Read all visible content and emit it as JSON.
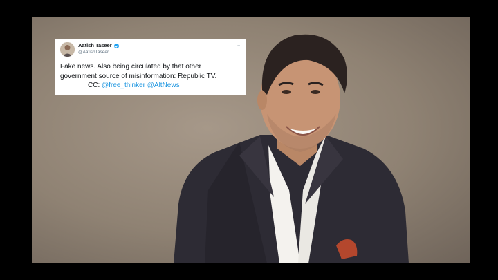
{
  "tweet": {
    "display_name": "Aatish Taseer",
    "handle": "@AatishTaseer",
    "verified": true,
    "text_line_1": "Fake news. Also being circulated by that other",
    "text_line_2": "government source of misinformation: Republic TV.",
    "cc_label": "CC:",
    "mention_1": "@free_thinker",
    "mention_2": "@AltNews",
    "menu_icon": "chevron-down-icon",
    "colors": {
      "text": "#14171a",
      "secondary": "#657786",
      "link": "#1b95e0",
      "verified": "#1da1f2"
    }
  },
  "photo": {
    "subject": "man in dark suit and white shirt with pocket square"
  }
}
